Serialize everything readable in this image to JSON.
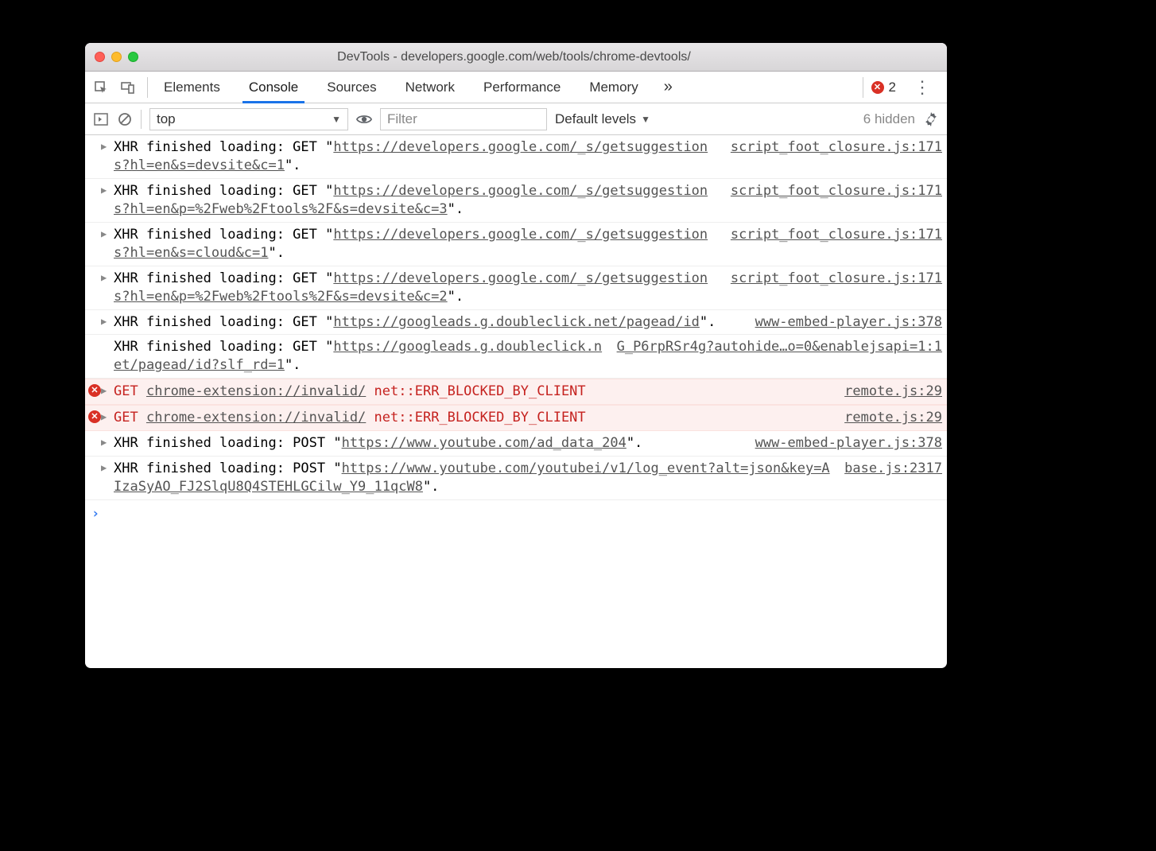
{
  "window": {
    "title": "DevTools - developers.google.com/web/tools/chrome-devtools/"
  },
  "tabs": {
    "items": [
      "Elements",
      "Console",
      "Sources",
      "Network",
      "Performance",
      "Memory"
    ],
    "active_index": 1,
    "overflow": "»",
    "error_count": "2"
  },
  "toolbar": {
    "context": "top",
    "filter_placeholder": "Filter",
    "filter_value": "",
    "levels": "Default levels",
    "hidden": "6 hidden"
  },
  "logs": [
    {
      "type": "xhr",
      "prefix": "XHR finished loading: GET \"",
      "url": "https://developers.google.com/_s/getsuggestions?hl=en&s=devsite&c=1",
      "suffix": "\".",
      "src": "script_foot_closure.js:171"
    },
    {
      "type": "xhr",
      "prefix": "XHR finished loading: GET \"",
      "url": "https://developers.google.com/_s/getsuggestions?hl=en&p=%2Fweb%2Ftools%2F&s=devsite&c=3",
      "suffix": "\".",
      "src": "script_foot_closure.js:171"
    },
    {
      "type": "xhr",
      "prefix": "XHR finished loading: GET \"",
      "url": "https://developers.google.com/_s/getsuggestions?hl=en&s=cloud&c=1",
      "suffix": "\".",
      "src": "script_foot_closure.js:171"
    },
    {
      "type": "xhr",
      "prefix": "XHR finished loading: GET \"",
      "url": "https://developers.google.com/_s/getsuggestions?hl=en&p=%2Fweb%2Ftools%2F&s=devsite&c=2",
      "suffix": "\".",
      "src": "script_foot_closure.js:171"
    },
    {
      "type": "xhr",
      "prefix": "XHR finished loading: GET \"",
      "url": "https://googleads.g.doubleclick.net/pagead/id",
      "suffix": "\".",
      "src": "www-embed-player.js:378"
    },
    {
      "type": "xhr_nodisclosure",
      "prefix": "XHR finished loading: GET \"",
      "url": "https://googleads.g.doubleclick.net/pagead/id?slf_rd=1",
      "suffix": "\".",
      "src": "G_P6rpRSr4g?autohide…o=0&enablejsapi=1:1"
    },
    {
      "type": "error",
      "get": "GET",
      "url": "chrome-extension://invalid/",
      "errmsg": "net::ERR_BLOCKED_BY_CLIENT",
      "src": "remote.js:29"
    },
    {
      "type": "error",
      "get": "GET",
      "url": "chrome-extension://invalid/",
      "errmsg": "net::ERR_BLOCKED_BY_CLIENT",
      "src": "remote.js:29"
    },
    {
      "type": "xhr",
      "prefix": "XHR finished loading: POST \"",
      "url": "https://www.youtube.com/ad_data_204",
      "suffix": "\".",
      "src": "www-embed-player.js:378"
    },
    {
      "type": "xhr",
      "prefix": "XHR finished loading: POST \"",
      "url": "https://www.youtube.com/youtubei/v1/log_event?alt=json&key=AIzaSyAO_FJ2SlqU8Q4STEHLGCilw_Y9_11qcW8",
      "suffix": "\".",
      "src": "base.js:2317"
    }
  ]
}
